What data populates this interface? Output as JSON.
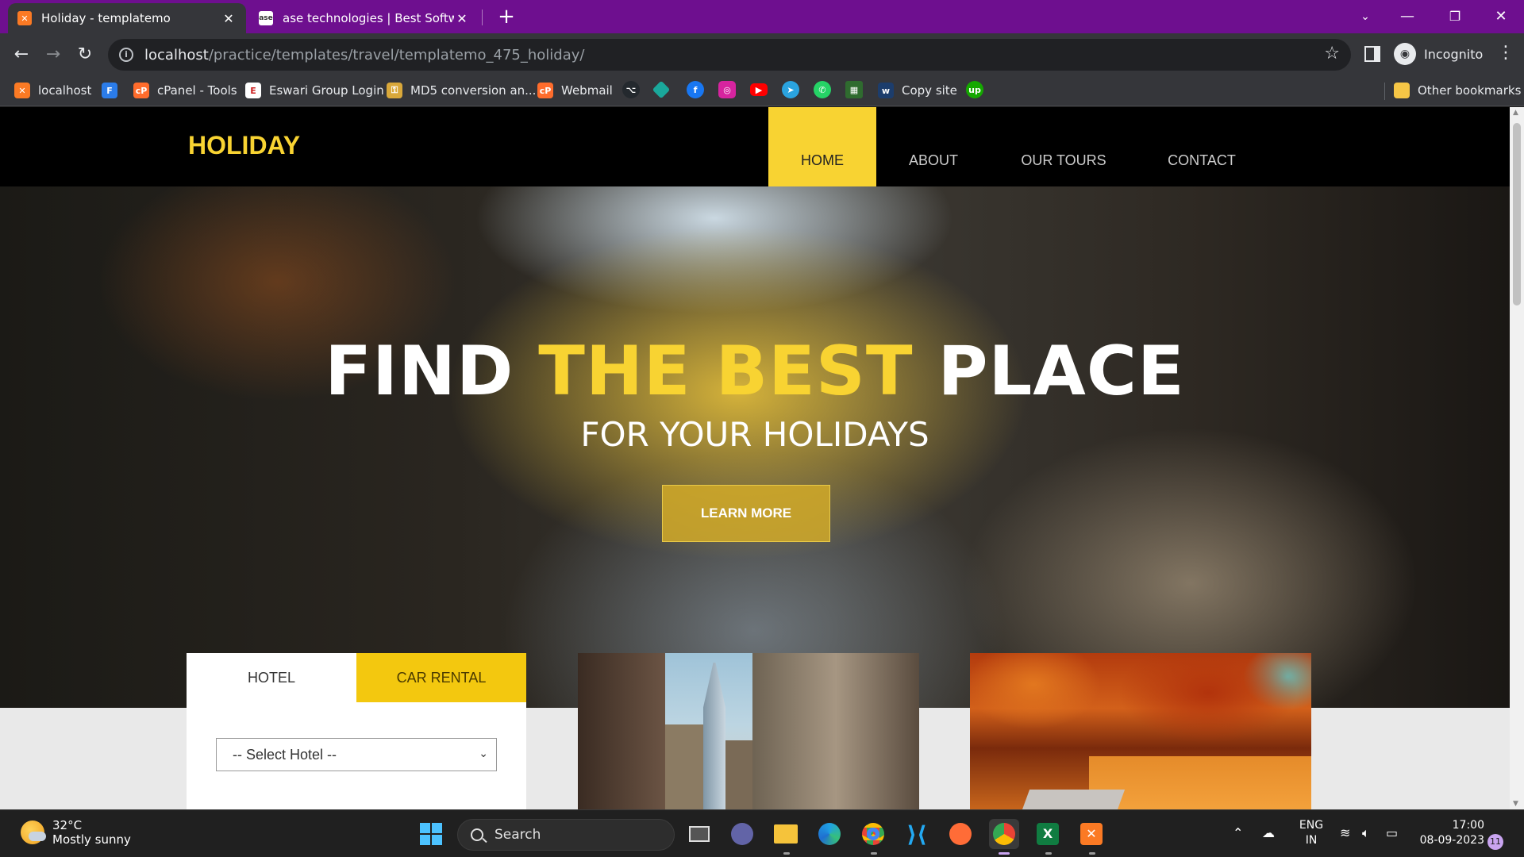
{
  "browser": {
    "tabs": [
      {
        "title": "Holiday - templatemo",
        "favicon": "xampp-icon",
        "active": true
      },
      {
        "title": "ase technologies | Best Software",
        "favicon": "ase-icon",
        "active": false
      }
    ],
    "url_host": "localhost",
    "url_path": "/practice/templates/travel/templatemo_475_holiday/",
    "profile_label": "Incognito",
    "bookmarks": [
      {
        "label": "localhost",
        "icon": "xampp-icon"
      },
      {
        "label": "",
        "icon": "f-icon"
      },
      {
        "label": "cPanel - Tools",
        "icon": "cpanel-icon"
      },
      {
        "label": "Eswari Group Login",
        "icon": "eswari-icon"
      },
      {
        "label": "MD5 conversion an...",
        "icon": "key-icon"
      },
      {
        "label": "Webmail",
        "icon": "cpanel-icon"
      },
      {
        "label": "Copy site",
        "icon": "w-icon"
      }
    ],
    "other_bookmarks": "Other bookmarks"
  },
  "site": {
    "logo": "HOLIDAY",
    "nav": [
      "HOME",
      "ABOUT",
      "OUR TOURS",
      "CONTACT"
    ],
    "active_nav": "HOME",
    "hero": {
      "title_part1": "FIND ",
      "title_highlight": "THE BEST",
      "title_part2": " PLACE",
      "subtitle": "FOR YOUR HOLIDAYS",
      "cta": "LEARN MORE"
    },
    "booking": {
      "tabs": [
        "HOTEL",
        "CAR RENTAL"
      ],
      "select_value": "-- Select Hotel --"
    },
    "colors": {
      "accent": "#f8d332",
      "header_bg": "#000000"
    }
  },
  "taskbar": {
    "weather_temp": "32°C",
    "weather_desc": "Mostly sunny",
    "search_label": "Search",
    "lang_line1": "ENG",
    "lang_line2": "IN",
    "time": "17:00",
    "date": "08-09-2023",
    "notification_count": "11"
  }
}
